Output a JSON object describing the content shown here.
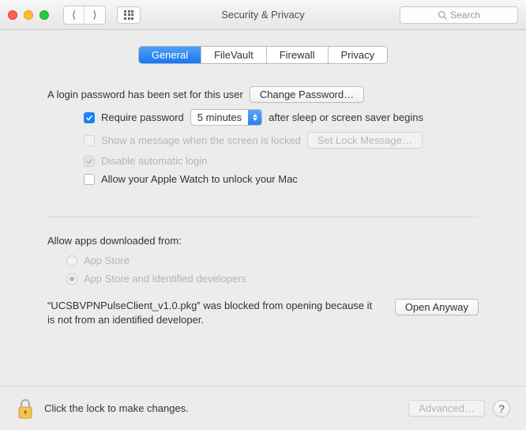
{
  "window": {
    "title": "Security & Privacy",
    "search_placeholder": "Search"
  },
  "tabs": [
    {
      "label": "General",
      "active": true
    },
    {
      "label": "FileVault",
      "active": false
    },
    {
      "label": "Firewall",
      "active": false
    },
    {
      "label": "Privacy",
      "active": false
    }
  ],
  "login": {
    "password_set_text": "A login password has been set for this user",
    "change_password_label": "Change Password…",
    "require_password_label": "Require password",
    "require_password_delay": "5 minutes",
    "require_password_suffix": "after sleep or screen saver begins",
    "show_message_label": "Show a message when the screen is locked",
    "set_lock_msg_label": "Set Lock Message…",
    "disable_auto_login_label": "Disable automatic login",
    "apple_watch_label": "Allow your Apple Watch to unlock your Mac"
  },
  "gatekeeper": {
    "heading": "Allow apps downloaded from:",
    "option_appstore": "App Store",
    "option_identified": "App Store and identified developers",
    "blocked_message": "“UCSBVPNPulseClient_v1.0.pkg” was blocked from opening because it is not from an identified developer.",
    "open_anyway_label": "Open Anyway"
  },
  "footer": {
    "lock_text": "Click the lock to make changes.",
    "advanced_label": "Advanced…",
    "help_label": "?"
  }
}
